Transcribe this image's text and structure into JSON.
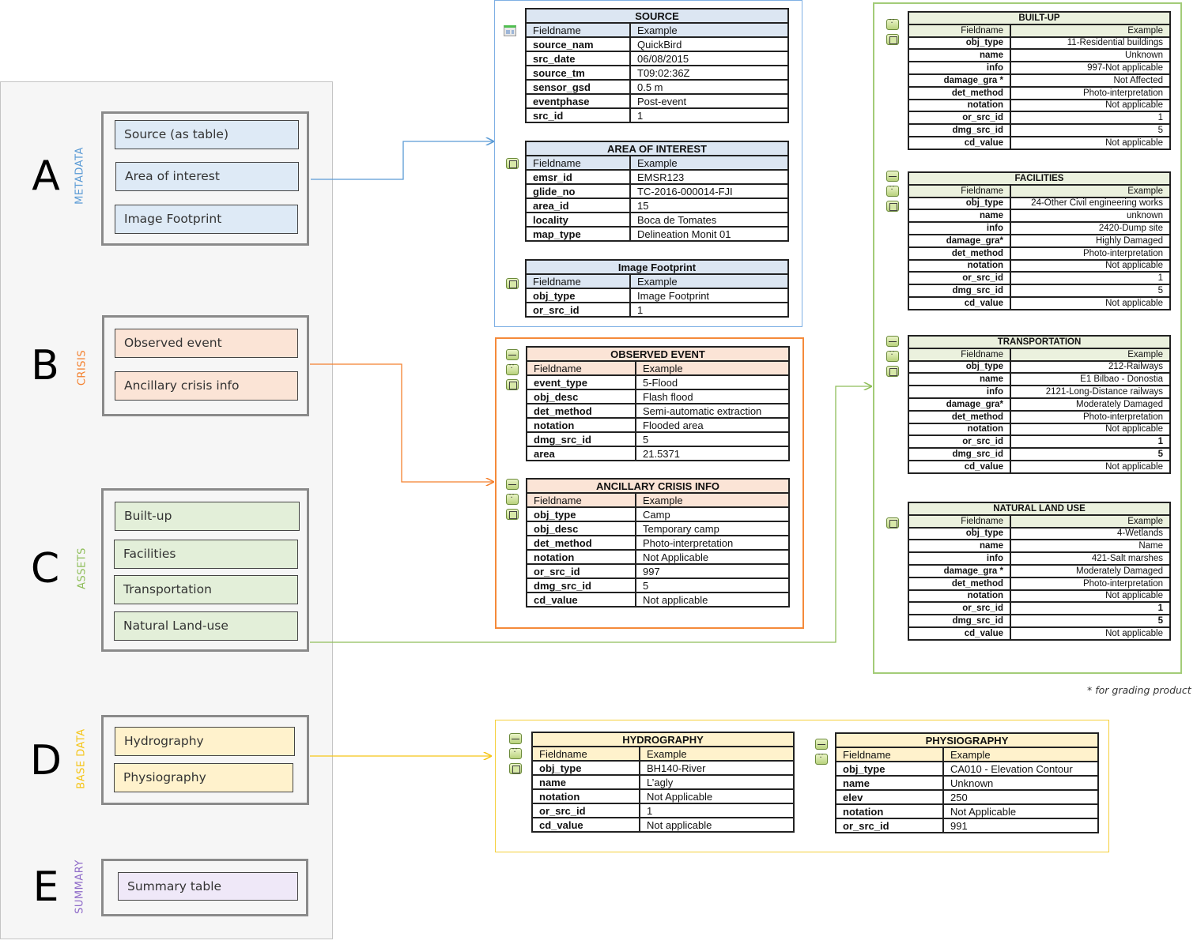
{
  "colors": {
    "metadata": "#5b9bd5",
    "crisis": "#f4812f",
    "assets": "#8fbe5a",
    "base_data": "#f5c518",
    "summary": "#8e6ac8"
  },
  "groups": [
    {
      "letter": "A",
      "label": "METADATA",
      "items": [
        "Source (as table)",
        "Area of interest",
        "Image Footprint"
      ]
    },
    {
      "letter": "B",
      "label": "CRISIS",
      "items": [
        "Observed event",
        "Ancillary crisis info"
      ]
    },
    {
      "letter": "C",
      "label": "ASSETS",
      "items": [
        "Built-up",
        "Facilities",
        "Transportation",
        "Natural Land-use"
      ]
    },
    {
      "letter": "D",
      "label": "BASE DATA",
      "items": [
        "Hydrography",
        "Physiography"
      ]
    },
    {
      "letter": "E",
      "label": "SUMMARY",
      "items": [
        "Summary table"
      ]
    }
  ],
  "tables": {
    "source": {
      "title": "SOURCE",
      "icons": [
        "table"
      ],
      "header": [
        "Fieldname",
        "Example"
      ],
      "rows": [
        [
          "source_nam",
          "QuickBird"
        ],
        [
          "src_date",
          "06/08/2015"
        ],
        [
          "source_tm",
          "T09:02:36Z"
        ],
        [
          "sensor_gsd",
          "0.5 m"
        ],
        [
          "eventphase",
          "Post-event"
        ],
        [
          "src_id",
          "1"
        ]
      ]
    },
    "aoi": {
      "title": "AREA OF INTEREST",
      "icons": [
        "polygon"
      ],
      "header": [
        "Fieldname",
        "Example"
      ],
      "rows": [
        [
          "emsr_id",
          "EMSR123"
        ],
        [
          "glide_no",
          "TC-2016-000014-FJI"
        ],
        [
          "area_id",
          "15"
        ],
        [
          "locality",
          "Boca de Tomates"
        ],
        [
          "map_type",
          "Delineation Monit 01"
        ]
      ]
    },
    "footprint": {
      "title": "Image Footprint",
      "icons": [
        "polygon"
      ],
      "header": [
        "Fieldname",
        "Example"
      ],
      "rows": [
        [
          "obj_type",
          "Image Footprint"
        ],
        [
          "or_src_id",
          "1"
        ]
      ]
    },
    "observed": {
      "title": "OBSERVED EVENT",
      "icons": [
        "line",
        "point",
        "polygon"
      ],
      "header": [
        "Fieldname",
        "Example"
      ],
      "rows": [
        [
          "event_type",
          "5-Flood"
        ],
        [
          "obj_desc",
          "Flash flood"
        ],
        [
          "det_method",
          "Semi-automatic extraction"
        ],
        [
          "notation",
          "Flooded area"
        ],
        [
          "dmg_src_id",
          "5"
        ],
        [
          "area",
          "21.5371"
        ]
      ]
    },
    "ancillary": {
      "title": "ANCILLARY CRISIS INFO",
      "icons": [
        "line",
        "point",
        "polygon"
      ],
      "header": [
        "Fieldname",
        "Example"
      ],
      "rows": [
        [
          "obj_type",
          "Camp"
        ],
        [
          "obj_desc",
          "Temporary camp"
        ],
        [
          "det_method",
          "Photo-interpretation"
        ],
        [
          "notation",
          "Not Applicable"
        ],
        [
          "or_src_id",
          "997"
        ],
        [
          "dmg_src_id",
          "5"
        ],
        [
          "cd_value",
          "Not applicable"
        ]
      ]
    },
    "builtup": {
      "title": "BUILT-UP",
      "icons": [
        "point",
        "polygon"
      ],
      "header": [
        "Fieldname",
        "Example"
      ],
      "rows": [
        [
          "obj_type",
          "11-Residential buildings"
        ],
        [
          "name",
          "Unknown"
        ],
        [
          "info",
          "997-Not applicable"
        ],
        [
          "damage_gra *",
          "Not Affected"
        ],
        [
          "det_method",
          "Photo-interpretation"
        ],
        [
          "notation",
          "Not applicable"
        ],
        [
          "or_src_id",
          "1"
        ],
        [
          "dmg_src_id",
          "5"
        ],
        [
          "cd_value",
          "Not applicable"
        ]
      ]
    },
    "facilities": {
      "title": "FACILITIES",
      "icons": [
        "line",
        "point",
        "polygon"
      ],
      "header": [
        "Fieldname",
        "Example"
      ],
      "rows": [
        [
          "obj_type",
          "24-Other Civil engineering works"
        ],
        [
          "name",
          "unknown"
        ],
        [
          "info",
          "2420-Dump site"
        ],
        [
          "damage_gra*",
          "Highly Damaged"
        ],
        [
          "det_method",
          "Photo-interpretation"
        ],
        [
          "notation",
          "Not applicable"
        ],
        [
          "or_src_id",
          "1"
        ],
        [
          "dmg_src_id",
          "5"
        ],
        [
          "cd_value",
          "Not applicable"
        ]
      ]
    },
    "transportation": {
      "title": "TRANSPORTATION",
      "icons": [
        "line",
        "point",
        "polygon"
      ],
      "header": [
        "Fieldname",
        "Example"
      ],
      "rows": [
        [
          "obj_type",
          "212-Railways"
        ],
        [
          "name",
          "E1 Bilbao - Donostia"
        ],
        [
          "info",
          "2121-Long-Distance railways"
        ],
        [
          "damage_gra*",
          "Moderately Damaged"
        ],
        [
          "det_method",
          "Photo-interpretation"
        ],
        [
          "notation",
          "Not applicable"
        ],
        [
          "or_src_id",
          "1"
        ],
        [
          "dmg_src_id",
          "5"
        ],
        [
          "cd_value",
          "Not applicable"
        ]
      ]
    },
    "natural": {
      "title": "NATURAL LAND USE",
      "icons": [
        "polygon"
      ],
      "header": [
        "Fieldname",
        "Example"
      ],
      "rows": [
        [
          "obj_type",
          "4-Wetlands"
        ],
        [
          "name",
          "Name"
        ],
        [
          "info",
          "421-Salt marshes"
        ],
        [
          "damage_gra *",
          "Moderately Damaged"
        ],
        [
          "det_method",
          "Photo-interpretation"
        ],
        [
          "notation",
          "Not applicable"
        ],
        [
          "or_src_id",
          "1"
        ],
        [
          "dmg_src_id",
          "5"
        ],
        [
          "cd_value",
          "Not applicable"
        ]
      ]
    },
    "hydrography": {
      "title": "HYDROGRAPHY",
      "icons": [
        "line",
        "point",
        "polygon"
      ],
      "header": [
        "Fieldname",
        "Example"
      ],
      "rows": [
        [
          "obj_type",
          "BH140-River"
        ],
        [
          "name",
          "L’agly"
        ],
        [
          "notation",
          "Not Applicable"
        ],
        [
          "or_src_id",
          "1"
        ],
        [
          "cd_value",
          "Not applicable"
        ]
      ]
    },
    "physiography": {
      "title": "PHYSIOGRAPHY",
      "icons": [
        "line",
        "point"
      ],
      "header": [
        "Fieldname",
        "Example"
      ],
      "rows": [
        [
          "obj_type",
          "CA010 - Elevation Contour"
        ],
        [
          "name",
          "Unknown"
        ],
        [
          "elev",
          "250"
        ],
        [
          "notation",
          "Not Applicable"
        ],
        [
          "or_src_id",
          "991"
        ]
      ]
    }
  },
  "footnote": "* for grading product"
}
